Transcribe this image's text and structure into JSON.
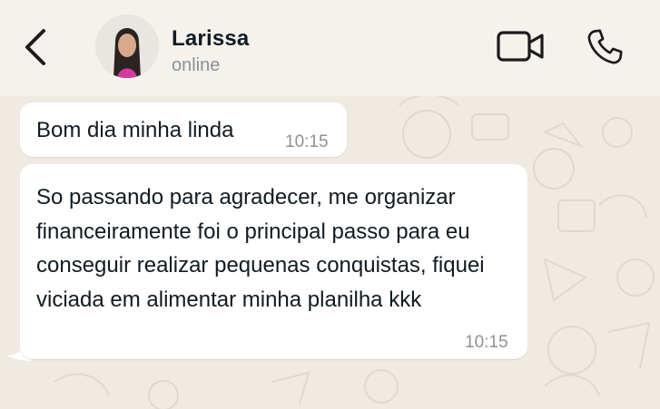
{
  "header": {
    "contact_name": "Larissa",
    "contact_status": "online",
    "icons": [
      "back-arrow-icon",
      "video-call-icon",
      "phone-icon"
    ]
  },
  "messages": [
    {
      "text": "Bom dia minha linda",
      "time": "10:15"
    },
    {
      "text": "So passando para agradecer, me organizar financeiramente foi o principal passo para eu conseguir realizar pequenas conquistas, fiquei viciada em alimentar minha planilha kkk",
      "time": "10:15"
    }
  ],
  "colors": {
    "header_bg": "#f5f2ee",
    "chat_bg": "#efeae2",
    "bubble_bg": "#ffffff",
    "text": "#111b21",
    "muted": "#8a9095"
  }
}
